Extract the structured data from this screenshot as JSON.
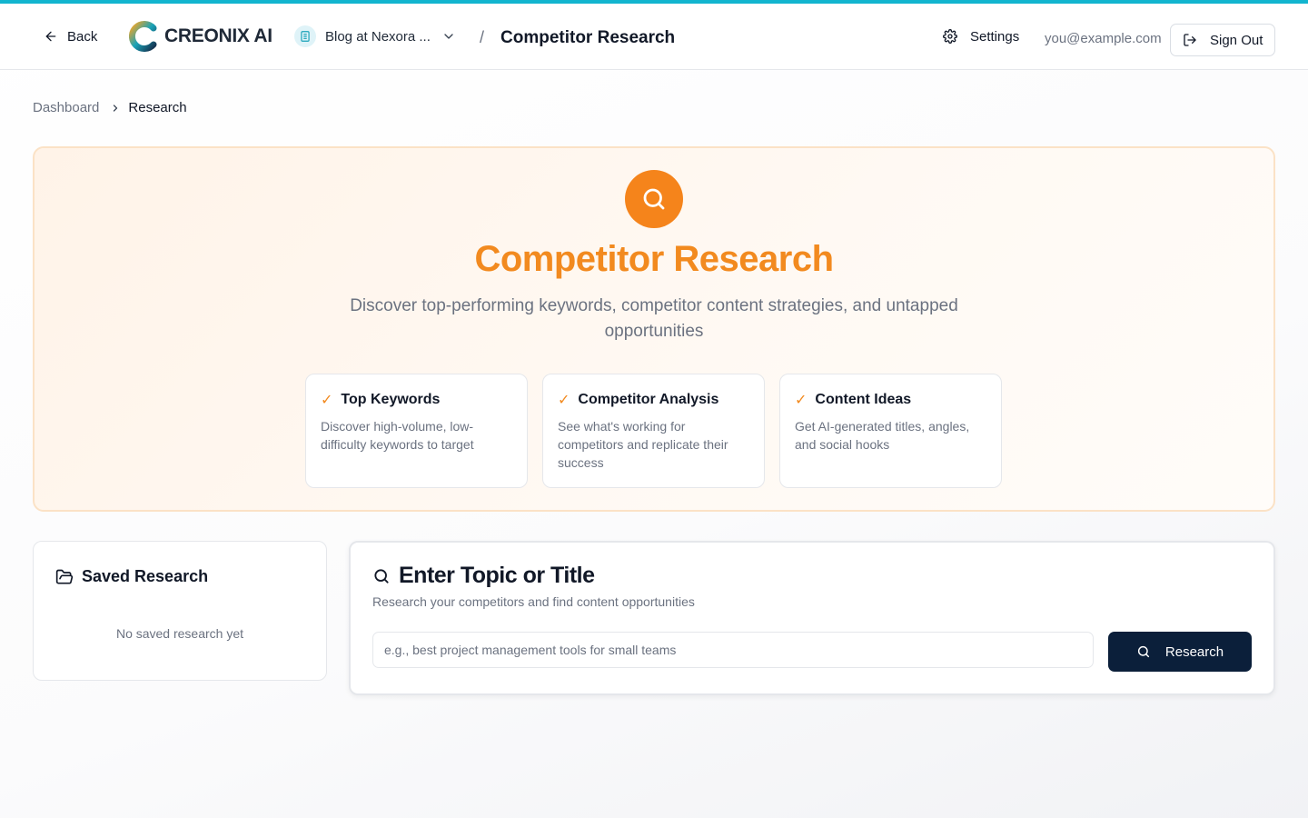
{
  "header": {
    "back_label": "Back",
    "brand": "CREONIX AI",
    "site_name": "Blog at Nexora ...",
    "separator": "/",
    "page_title": "Competitor Research",
    "settings_label": "Settings",
    "user_email": "you@example.com",
    "sign_out_label": "Sign Out"
  },
  "breadcrumb": {
    "items": [
      "Dashboard",
      "Research"
    ]
  },
  "hero": {
    "icon": "search-icon",
    "title": "Competitor Research",
    "subtitle": "Discover top-performing keywords, competitor content strategies, and untapped opportunities",
    "check_glyph": "✓",
    "features": [
      {
        "title": "Top Keywords",
        "description": "Discover high-volume, low-difficulty keywords to target"
      },
      {
        "title": "Competitor Analysis",
        "description": "See what's working for competitors and replicate their success"
      },
      {
        "title": "Content Ideas",
        "description": "Get AI-generated titles, angles, and social hooks"
      }
    ]
  },
  "saved": {
    "title": "Saved Research",
    "empty_text": "No saved research yet"
  },
  "research": {
    "title": "Enter Topic or Title",
    "subtitle": "Research your competitors and find content opportunities",
    "placeholder": "e.g., best project management tools for small teams",
    "value": "",
    "button_label": "Research"
  },
  "colors": {
    "accent_top_bar": "#12b5cf",
    "hero_orange": "#f28a1f",
    "primary_button": "#0b1f3a"
  }
}
